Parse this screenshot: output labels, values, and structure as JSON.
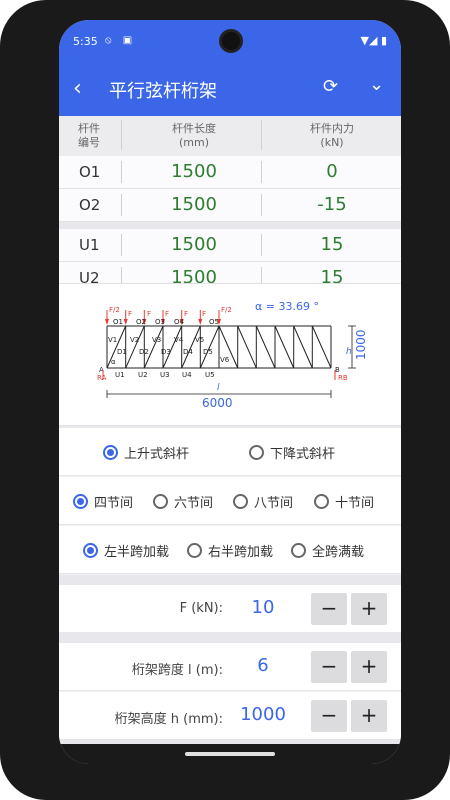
{
  "status": {
    "time": "5:35"
  },
  "appbar": {
    "title": "平行弦杆桁架",
    "back_icon": "‹",
    "reset_icon": "⟳",
    "expand_icon": "⌄"
  },
  "table": {
    "headers": {
      "id": "杆件\n编号",
      "length": "杆件长度\n(mm)",
      "force": "杆件内力\n(kN)"
    },
    "rows": [
      {
        "id": "O1",
        "length": "1500",
        "force": "0"
      },
      {
        "id": "O2",
        "length": "1500",
        "force": "-15"
      },
      {
        "id": "U1",
        "length": "1500",
        "force": "15"
      },
      {
        "id": "U2",
        "length": "1500",
        "force": "15"
      }
    ]
  },
  "diagram": {
    "angle_label": "α = 33.69 °",
    "height_label": "1000",
    "span_label": "6000",
    "h_symbol": "h",
    "l_symbol": "l",
    "top_labels": [
      "O1",
      "O2",
      "O3",
      "O4",
      "O5"
    ],
    "bottom_labels": [
      "U1",
      "U2",
      "U3",
      "U4",
      "U5"
    ],
    "vertical_labels": [
      "V1",
      "V2",
      "V3",
      "V4",
      "V5",
      "V6"
    ],
    "diag_labels": [
      "D1",
      "D2",
      "D3",
      "D4",
      "D5"
    ],
    "force_label": "F",
    "half_force_label": "F/2",
    "support_a": "A",
    "support_b": "B",
    "reaction_a": "RA",
    "reaction_b": "RB",
    "alpha_symbol": "α"
  },
  "diagonal_type": {
    "options": [
      "上升式斜杆",
      "下降式斜杆"
    ],
    "selected": "上升式斜杆"
  },
  "panel_count": {
    "options": [
      "四节间",
      "六节间",
      "八节间",
      "十节间"
    ],
    "selected": "四节间"
  },
  "load_case": {
    "options": [
      "左半跨加载",
      "右半跨加载",
      "全跨满载"
    ],
    "selected": "左半跨加载"
  },
  "params": {
    "force": {
      "label": "F (kN):",
      "value": "10"
    },
    "span": {
      "label": "桁架跨度 l (m):",
      "value": "6"
    },
    "height": {
      "label": "桁架高度 h (mm):",
      "value": "1000"
    },
    "minus": "−",
    "plus": "+"
  }
}
